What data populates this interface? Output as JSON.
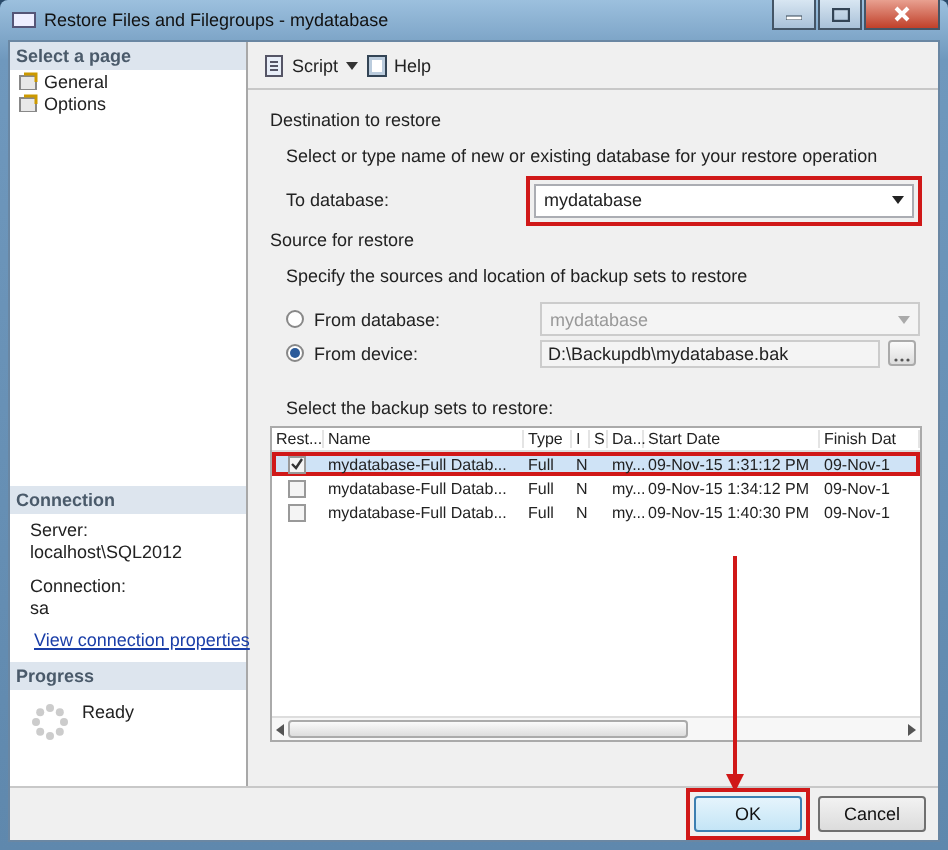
{
  "window": {
    "title": "Restore Files and Filegroups - mydatabase"
  },
  "sidebar": {
    "header": "Select a page",
    "items": [
      {
        "label": "General",
        "selected": false
      },
      {
        "label": "Options",
        "selected": false
      }
    ]
  },
  "connection": {
    "header": "Connection",
    "server_label": "Server:",
    "server": "localhost\\SQL2012",
    "connection_label": "Connection:",
    "user": "sa",
    "link": "View connection properties"
  },
  "progress": {
    "header": "Progress",
    "status": "Ready"
  },
  "toolbar": {
    "script": "Script",
    "help": "Help"
  },
  "destination": {
    "header": "Destination to restore",
    "hint": "Select or type name of new or existing database for your restore operation",
    "label": "To database:",
    "value": "mydatabase",
    "highlighted": true
  },
  "source": {
    "header": "Source for restore",
    "hint": "Specify the sources and location of backup sets to restore",
    "options": [
      {
        "label": "From database:",
        "selected": false,
        "value": "mydatabase",
        "disabled": true
      },
      {
        "label": "From device:",
        "selected": true,
        "value": "D:\\Backupdb\\mydatabase.bak",
        "disabled": false
      }
    ]
  },
  "backup_sets": {
    "label": "Select the backup sets to restore:",
    "columns": [
      "Rest...",
      "Name",
      "Type",
      "I",
      "S",
      "Da...",
      "Start Date",
      "Finish Dat"
    ],
    "rows": [
      {
        "checked": true,
        "selected": true,
        "highlighted": true,
        "name": "mydatabase-Full Datab...",
        "type": "Full",
        "column_4": "N",
        "database": "my...",
        "start": "09-Nov-15 1:31:12 PM",
        "finish": "09-Nov-1"
      },
      {
        "checked": false,
        "selected": false,
        "highlighted": false,
        "name": "mydatabase-Full Datab...",
        "type": "Full",
        "column_4": "N",
        "database": "my...",
        "start": "09-Nov-15 1:34:12 PM",
        "finish": "09-Nov-1"
      },
      {
        "checked": false,
        "selected": false,
        "highlighted": false,
        "name": "mydatabase-Full Datab...",
        "type": "Full",
        "column_4": "N",
        "database": "my...",
        "start": "09-Nov-15 1:40:30 PM",
        "finish": "09-Nov-1"
      }
    ]
  },
  "buttons": [
    {
      "label": "OK",
      "highlighted": true
    },
    {
      "label": "Cancel",
      "highlighted": false
    }
  ]
}
